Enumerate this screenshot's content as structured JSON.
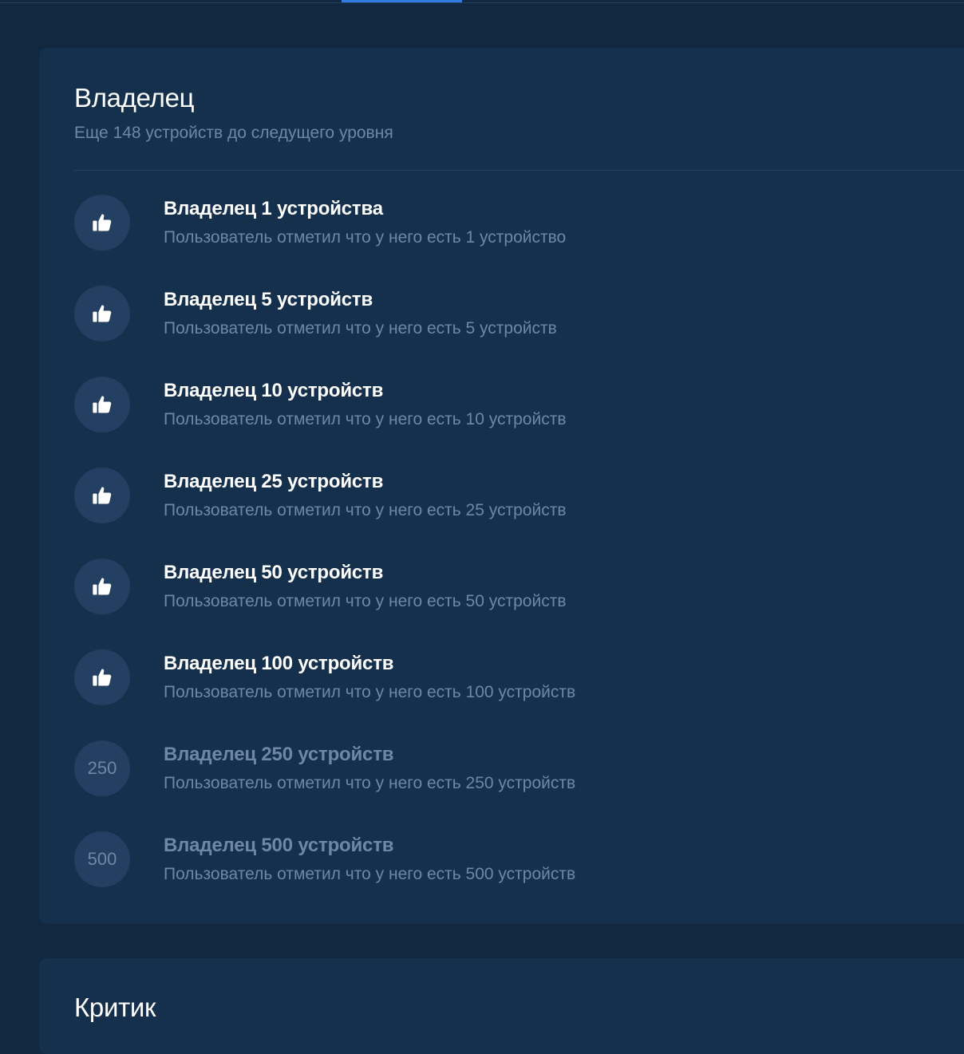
{
  "owner_card": {
    "title": "Владелец",
    "subtitle": "Еще 148 устройств до следущего уровня",
    "achievements": [
      {
        "title": "Владелец 1 устройства",
        "description": "Пользователь отметил что у него есть 1 устройство",
        "icon": "thumbs-up-icon",
        "unlocked": true
      },
      {
        "title": "Владелец 5 устройств",
        "description": "Пользователь отметил что у него есть 5 устройств",
        "icon": "thumbs-up-icon",
        "unlocked": true
      },
      {
        "title": "Владелец 10 устройств",
        "description": "Пользователь отметил что у него есть 10 устройств",
        "icon": "thumbs-up-icon",
        "unlocked": true
      },
      {
        "title": "Владелец 25 устройств",
        "description": "Пользователь отметил что у него есть 25 устройств",
        "icon": "thumbs-up-icon",
        "unlocked": true
      },
      {
        "title": "Владелец 50 устройств",
        "description": "Пользователь отметил что у него есть 50 устройств",
        "icon": "thumbs-up-icon",
        "unlocked": true
      },
      {
        "title": "Владелец 100 устройств",
        "description": "Пользователь отметил что у него есть 100 устройств",
        "icon": "thumbs-up-icon",
        "unlocked": true
      },
      {
        "title": "Владелец 250 устройств",
        "description": "Пользователь отметил что у него есть 250 устройств",
        "badge_text": "250",
        "unlocked": false
      },
      {
        "title": "Владелец 500 устройств",
        "description": "Пользователь отметил что у него есть 500 устройств",
        "badge_text": "500",
        "unlocked": false
      }
    ]
  },
  "critic_card": {
    "title": "Критик"
  },
  "colors": {
    "page_background": "#122740",
    "card_background": "#15304d",
    "badge_background": "#233f62",
    "accent": "#2f7de1",
    "title_text": "#ffffff",
    "muted_text": "#6d87a5"
  }
}
